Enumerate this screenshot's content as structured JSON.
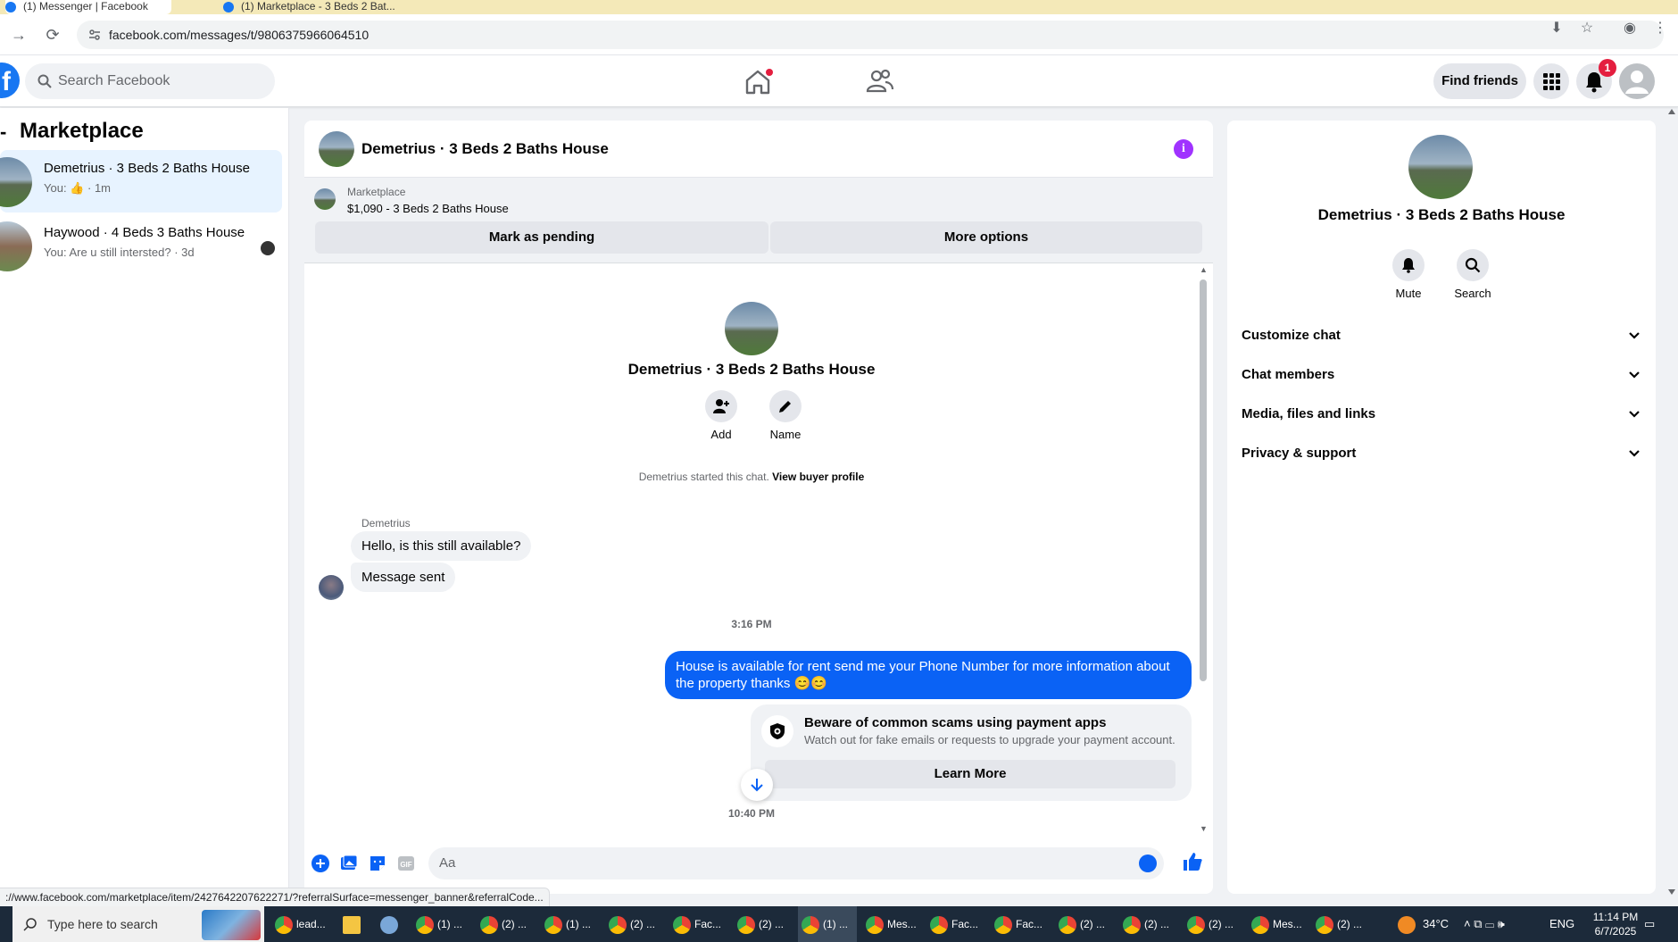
{
  "browser": {
    "url": "facebook.com/messages/t/9806375966064510",
    "tabs": [
      {
        "label": "(1) Messenger | Facebook"
      },
      {
        "label": "(1) Marketplace - 3 Beds 2 Bat..."
      }
    ]
  },
  "fb_header": {
    "search_placeholder": "Search Facebook",
    "find_friends": "Find friends",
    "notif_count": "1"
  },
  "left_panel": {
    "title": "Marketplace",
    "conversations": [
      {
        "name": "Demetrius · 3 Beds 2 Baths House",
        "sub_prefix": "You:",
        "sub_suffix": "· 1m"
      },
      {
        "name": "Haywood · 4 Beds 3 Baths House",
        "sub": "You: Are u still intersted? · 3d"
      }
    ]
  },
  "chat": {
    "title": "Demetrius · 3 Beds 2 Baths House",
    "banner": {
      "label": "Marketplace",
      "price_line": "$1,090 - 3 Beds 2 Baths House",
      "mark_pending": "Mark as pending",
      "more_options": "More options"
    },
    "intro": {
      "name": "Demetrius · 3 Beds 2 Baths House",
      "add_label": "Add",
      "name_label": "Name",
      "started_text": "Demetrius started this chat.",
      "view_buyer": "View buyer profile"
    },
    "messages": {
      "sender": "Demetrius",
      "in_1": "Hello, is this still available?",
      "in_2": "Message sent",
      "time_1": "3:16 PM",
      "out_1": "House is available for rent send me your Phone Number for more information about the property thanks 😊😊",
      "time_2": "10:40 PM"
    },
    "scam_card": {
      "title": "Beware of common scams using payment apps",
      "desc": "Watch out for fake emails or requests to upgrade your payment account.",
      "button": "Learn More"
    },
    "composer_placeholder": "Aa"
  },
  "right_panel": {
    "name": "Demetrius · 3 Beds 2 Baths House",
    "mute": "Mute",
    "search": "Search",
    "sections": [
      {
        "label": "Customize chat"
      },
      {
        "label": "Chat members"
      },
      {
        "label": "Media, files and links"
      },
      {
        "label": "Privacy & support"
      }
    ]
  },
  "status_url": "://www.facebook.com/marketplace/item/2427642207622271/?referralSurface=messenger_banner&referralCode...",
  "taskbar": {
    "search_placeholder": "Type here to search",
    "items": [
      {
        "label": "lead..."
      },
      {
        "label": ""
      },
      {
        "label": ""
      },
      {
        "label": "(1) ..."
      },
      {
        "label": "(2) ..."
      },
      {
        "label": "(1) ..."
      },
      {
        "label": "(2) ..."
      },
      {
        "label": "Fac..."
      },
      {
        "label": "(2) ..."
      },
      {
        "label": "(1) ..."
      },
      {
        "label": "Mes..."
      },
      {
        "label": "Fac..."
      },
      {
        "label": "Fac..."
      },
      {
        "label": "(2) ..."
      },
      {
        "label": "(2) ..."
      },
      {
        "label": "(2) ..."
      },
      {
        "label": "Mes..."
      },
      {
        "label": "(2) ..."
      }
    ],
    "weather": "34°C",
    "lang": "ENG",
    "time": "11:14 PM",
    "date": "6/7/2025"
  },
  "colors": {
    "fb_blue": "#1877f2",
    "messenger_blue": "#0a62f5",
    "info_purple": "#a033ff"
  }
}
